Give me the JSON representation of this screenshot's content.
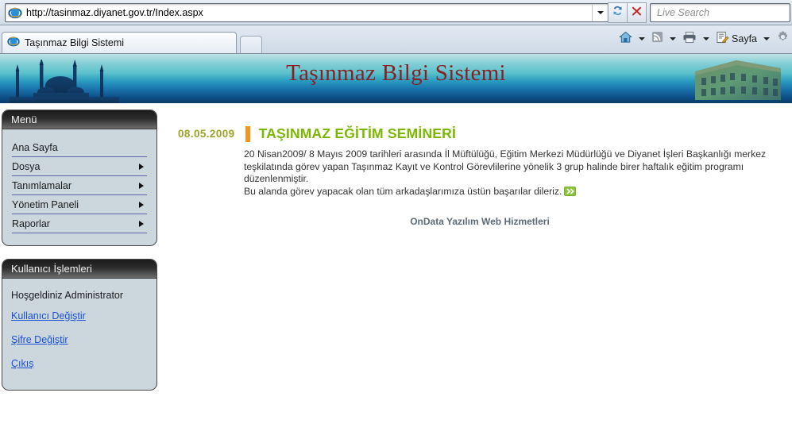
{
  "browser": {
    "url": "http://tasinmaz.diyanet.gov.tr/Index.aspx",
    "search_placeholder": "Live Search",
    "tab_title": "Taşınmaz Bilgi Sistemi",
    "refresh_icon": "refresh-icon",
    "stop_icon": "stop-icon",
    "address_dropdown_icon": "chevron-down-icon",
    "newtab_label": "",
    "commands": [
      {
        "icon": "home-icon",
        "label": "",
        "has_caret": true
      },
      {
        "icon": "rss-feed-icon",
        "label": "",
        "has_caret": true
      },
      {
        "icon": "print-icon",
        "label": "",
        "has_caret": true
      },
      {
        "icon": "page-icon",
        "label": "Sayfa",
        "has_caret": true
      },
      {
        "icon": "gear-icon",
        "label": "",
        "has_caret": false
      }
    ]
  },
  "banner": {
    "title": "Taşınmaz Bilgi Sistemi",
    "left_image": "mosque-silhouette",
    "right_image": "building-photo",
    "gradient_top": "#bfe3e6",
    "gradient_bottom": "#0a3d6b",
    "title_color": "#8c1f1f"
  },
  "menu_panel": {
    "header": "Menü",
    "items": [
      {
        "label": "Ana Sayfa",
        "has_submenu": false
      },
      {
        "label": "Dosya",
        "has_submenu": true
      },
      {
        "label": "Tanımlamalar",
        "has_submenu": true
      },
      {
        "label": "Yönetim Paneli",
        "has_submenu": true
      },
      {
        "label": "Raporlar",
        "has_submenu": true
      }
    ]
  },
  "user_panel": {
    "header": "Kullanıcı İşlemleri",
    "welcome": "Hoşgeldiniz Administrator",
    "links": [
      "Kullanıcı Değiştir",
      "Şifre Değiştir",
      "Çıkış"
    ],
    "link_color": "#1a4fd6"
  },
  "article": {
    "date": "08.05.2009",
    "title": "TAŞINMAZ EĞİTİM SEMİNERİ",
    "paragraph1": "20 Nisan2009/ 8 Mayıs 2009 tarihleri arasında İl Müftülüğü, Eğitim Merkezi Müdürlüğü ve Diyanet İşleri Başkanlığı merkez teşkilatında görev yapan Taşınmaz Kayıt ve Kontrol Görevlilerine yönelik 3 grup halinde birer haftalık eğitim programı düzenlenmiştir.",
    "paragraph2": "Bu alanda görev yapacak olan tüm arkadaşlarımıza üstün başarılar dileriz.",
    "more_icon": "double-chevron-right-icon",
    "date_color": "#9aa428",
    "title_color": "#7ab800",
    "bar_color": "#f7941e"
  },
  "footer": {
    "text": "OnData Yazılım Web Hizmetleri"
  }
}
